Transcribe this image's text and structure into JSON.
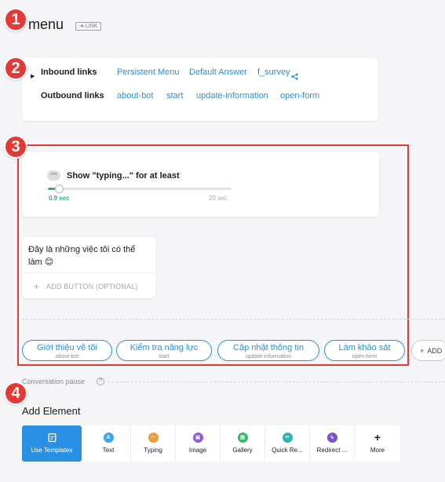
{
  "header": {
    "title": "menu",
    "link_badge": "LINK"
  },
  "links": {
    "inbound_label": "Inbound links",
    "inbound": [
      "Persistent Menu",
      "Default Answer",
      "f_survey"
    ],
    "outbound_label": "Outbound links",
    "outbound": [
      "about-bot",
      "start",
      "update-information",
      "open-form"
    ]
  },
  "typing": {
    "label": "Show \"typing...\" for at least",
    "min_label": "0.9 sec",
    "max_label": "20 sec",
    "value_fraction": 0.06
  },
  "message": {
    "text": "Đây là những việc tôi có thể làm 😊",
    "add_button": "ADD BUTTON (OPTIONAL)"
  },
  "quick_replies": [
    {
      "label": "Giới thiệu về tôi",
      "target": "about-bot"
    },
    {
      "label": "Kiểm tra năng lực",
      "target": "start"
    },
    {
      "label": "Cập nhật thông tin",
      "target": "update-information"
    },
    {
      "label": "Làm khảo sát",
      "target": "open-form"
    }
  ],
  "add_quick_reply": "ADD",
  "conversation_pause": "Conversation pause",
  "add_element": {
    "title": "Add Element",
    "tools": [
      {
        "label": "Use Templates",
        "icon": "template-icon",
        "color": "#ffffff",
        "glyph": ""
      },
      {
        "label": "Text",
        "icon": "text-icon",
        "color": "#3aa8e8",
        "glyph": "A"
      },
      {
        "label": "Typing",
        "icon": "typing-icon",
        "color": "#f39a3a",
        "glyph": "···"
      },
      {
        "label": "Image",
        "icon": "image-icon",
        "color": "#8f5bd6",
        "glyph": "▣"
      },
      {
        "label": "Gallery",
        "icon": "gallery-icon",
        "color": "#37b86b",
        "glyph": "▦"
      },
      {
        "label": "Quick Re...",
        "icon": "quick-reply-icon",
        "color": "#2fb5b0",
        "glyph": "••"
      },
      {
        "label": "Redirect ...",
        "icon": "redirect-icon",
        "color": "#7a52c9",
        "glyph": "↳"
      },
      {
        "label": "More",
        "icon": "plus-icon",
        "color": "#222222",
        "glyph": "+"
      }
    ]
  },
  "markers": [
    "1",
    "2",
    "3",
    "4"
  ],
  "colors": {
    "accent": "#2a90d9",
    "marker": "#e53935",
    "success": "#2db38a"
  }
}
